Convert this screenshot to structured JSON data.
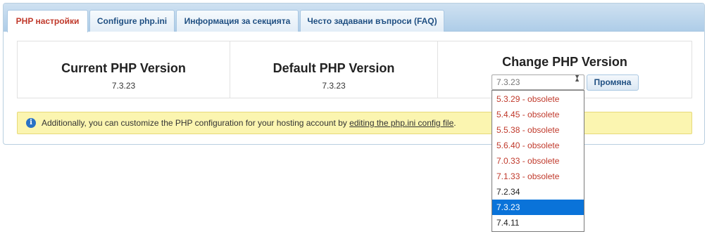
{
  "tabs": [
    {
      "label": "PHP настройки",
      "active": true
    },
    {
      "label": "Configure php.ini",
      "active": false
    },
    {
      "label": "Информация за секцията",
      "active": false
    },
    {
      "label": "Често задавани въпроси (FAQ)",
      "active": false
    }
  ],
  "current": {
    "title": "Current PHP Version",
    "value": "7.3.23"
  },
  "default": {
    "title": "Default PHP Version",
    "value": "7.3.23"
  },
  "change": {
    "title": "Change PHP Version",
    "selected_value": "7.3.23",
    "button_label": "Промяна"
  },
  "alert": {
    "text_before": "Additionally, you can customize the PHP configuration for your hosting account by ",
    "link_text": "editing the php.ini config file",
    "text_after": "."
  },
  "dropdown_options": [
    {
      "label": "5.3.29 - obsolete",
      "status": "obsolete"
    },
    {
      "label": "5.4.45 - obsolete",
      "status": "obsolete"
    },
    {
      "label": "5.5.38 - obsolete",
      "status": "obsolete"
    },
    {
      "label": "5.6.40 - obsolete",
      "status": "obsolete"
    },
    {
      "label": "7.0.33 - obsolete",
      "status": "obsolete"
    },
    {
      "label": "7.1.33 - obsolete",
      "status": "obsolete"
    },
    {
      "label": "7.2.34",
      "status": "normal"
    },
    {
      "label": "7.3.23",
      "status": "selected"
    },
    {
      "label": "7.4.11",
      "status": "normal"
    }
  ],
  "colors": {
    "active_tab_text": "#c0392b",
    "tab_text": "#1f4f82",
    "obsolete_text": "#c0392b",
    "selected_option_bg": "#0a73d9",
    "alert_bg": "#fbf5b0"
  }
}
